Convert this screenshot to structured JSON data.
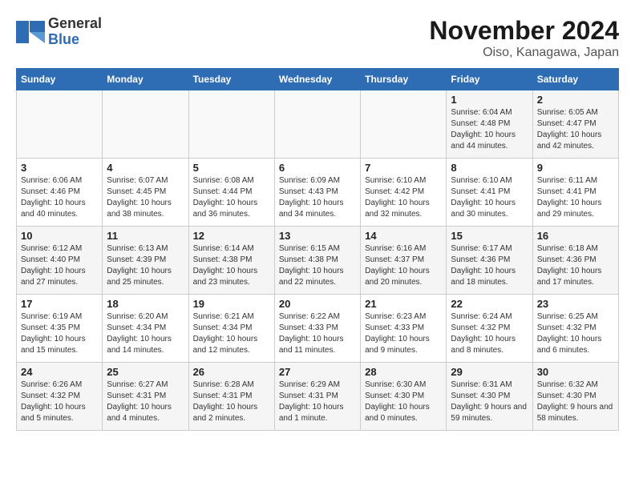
{
  "header": {
    "logo_general": "General",
    "logo_blue": "Blue",
    "title": "November 2024",
    "subtitle": "Oiso, Kanagawa, Japan"
  },
  "calendar": {
    "days_of_week": [
      "Sunday",
      "Monday",
      "Tuesday",
      "Wednesday",
      "Thursday",
      "Friday",
      "Saturday"
    ],
    "weeks": [
      [
        {
          "day": "",
          "info": ""
        },
        {
          "day": "",
          "info": ""
        },
        {
          "day": "",
          "info": ""
        },
        {
          "day": "",
          "info": ""
        },
        {
          "day": "",
          "info": ""
        },
        {
          "day": "1",
          "info": "Sunrise: 6:04 AM\nSunset: 4:48 PM\nDaylight: 10 hours and 44 minutes."
        },
        {
          "day": "2",
          "info": "Sunrise: 6:05 AM\nSunset: 4:47 PM\nDaylight: 10 hours and 42 minutes."
        }
      ],
      [
        {
          "day": "3",
          "info": "Sunrise: 6:06 AM\nSunset: 4:46 PM\nDaylight: 10 hours and 40 minutes."
        },
        {
          "day": "4",
          "info": "Sunrise: 6:07 AM\nSunset: 4:45 PM\nDaylight: 10 hours and 38 minutes."
        },
        {
          "day": "5",
          "info": "Sunrise: 6:08 AM\nSunset: 4:44 PM\nDaylight: 10 hours and 36 minutes."
        },
        {
          "day": "6",
          "info": "Sunrise: 6:09 AM\nSunset: 4:43 PM\nDaylight: 10 hours and 34 minutes."
        },
        {
          "day": "7",
          "info": "Sunrise: 6:10 AM\nSunset: 4:42 PM\nDaylight: 10 hours and 32 minutes."
        },
        {
          "day": "8",
          "info": "Sunrise: 6:10 AM\nSunset: 4:41 PM\nDaylight: 10 hours and 30 minutes."
        },
        {
          "day": "9",
          "info": "Sunrise: 6:11 AM\nSunset: 4:41 PM\nDaylight: 10 hours and 29 minutes."
        }
      ],
      [
        {
          "day": "10",
          "info": "Sunrise: 6:12 AM\nSunset: 4:40 PM\nDaylight: 10 hours and 27 minutes."
        },
        {
          "day": "11",
          "info": "Sunrise: 6:13 AM\nSunset: 4:39 PM\nDaylight: 10 hours and 25 minutes."
        },
        {
          "day": "12",
          "info": "Sunrise: 6:14 AM\nSunset: 4:38 PM\nDaylight: 10 hours and 23 minutes."
        },
        {
          "day": "13",
          "info": "Sunrise: 6:15 AM\nSunset: 4:38 PM\nDaylight: 10 hours and 22 minutes."
        },
        {
          "day": "14",
          "info": "Sunrise: 6:16 AM\nSunset: 4:37 PM\nDaylight: 10 hours and 20 minutes."
        },
        {
          "day": "15",
          "info": "Sunrise: 6:17 AM\nSunset: 4:36 PM\nDaylight: 10 hours and 18 minutes."
        },
        {
          "day": "16",
          "info": "Sunrise: 6:18 AM\nSunset: 4:36 PM\nDaylight: 10 hours and 17 minutes."
        }
      ],
      [
        {
          "day": "17",
          "info": "Sunrise: 6:19 AM\nSunset: 4:35 PM\nDaylight: 10 hours and 15 minutes."
        },
        {
          "day": "18",
          "info": "Sunrise: 6:20 AM\nSunset: 4:34 PM\nDaylight: 10 hours and 14 minutes."
        },
        {
          "day": "19",
          "info": "Sunrise: 6:21 AM\nSunset: 4:34 PM\nDaylight: 10 hours and 12 minutes."
        },
        {
          "day": "20",
          "info": "Sunrise: 6:22 AM\nSunset: 4:33 PM\nDaylight: 10 hours and 11 minutes."
        },
        {
          "day": "21",
          "info": "Sunrise: 6:23 AM\nSunset: 4:33 PM\nDaylight: 10 hours and 9 minutes."
        },
        {
          "day": "22",
          "info": "Sunrise: 6:24 AM\nSunset: 4:32 PM\nDaylight: 10 hours and 8 minutes."
        },
        {
          "day": "23",
          "info": "Sunrise: 6:25 AM\nSunset: 4:32 PM\nDaylight: 10 hours and 6 minutes."
        }
      ],
      [
        {
          "day": "24",
          "info": "Sunrise: 6:26 AM\nSunset: 4:32 PM\nDaylight: 10 hours and 5 minutes."
        },
        {
          "day": "25",
          "info": "Sunrise: 6:27 AM\nSunset: 4:31 PM\nDaylight: 10 hours and 4 minutes."
        },
        {
          "day": "26",
          "info": "Sunrise: 6:28 AM\nSunset: 4:31 PM\nDaylight: 10 hours and 2 minutes."
        },
        {
          "day": "27",
          "info": "Sunrise: 6:29 AM\nSunset: 4:31 PM\nDaylight: 10 hours and 1 minute."
        },
        {
          "day": "28",
          "info": "Sunrise: 6:30 AM\nSunset: 4:30 PM\nDaylight: 10 hours and 0 minutes."
        },
        {
          "day": "29",
          "info": "Sunrise: 6:31 AM\nSunset: 4:30 PM\nDaylight: 9 hours and 59 minutes."
        },
        {
          "day": "30",
          "info": "Sunrise: 6:32 AM\nSunset: 4:30 PM\nDaylight: 9 hours and 58 minutes."
        }
      ]
    ]
  }
}
